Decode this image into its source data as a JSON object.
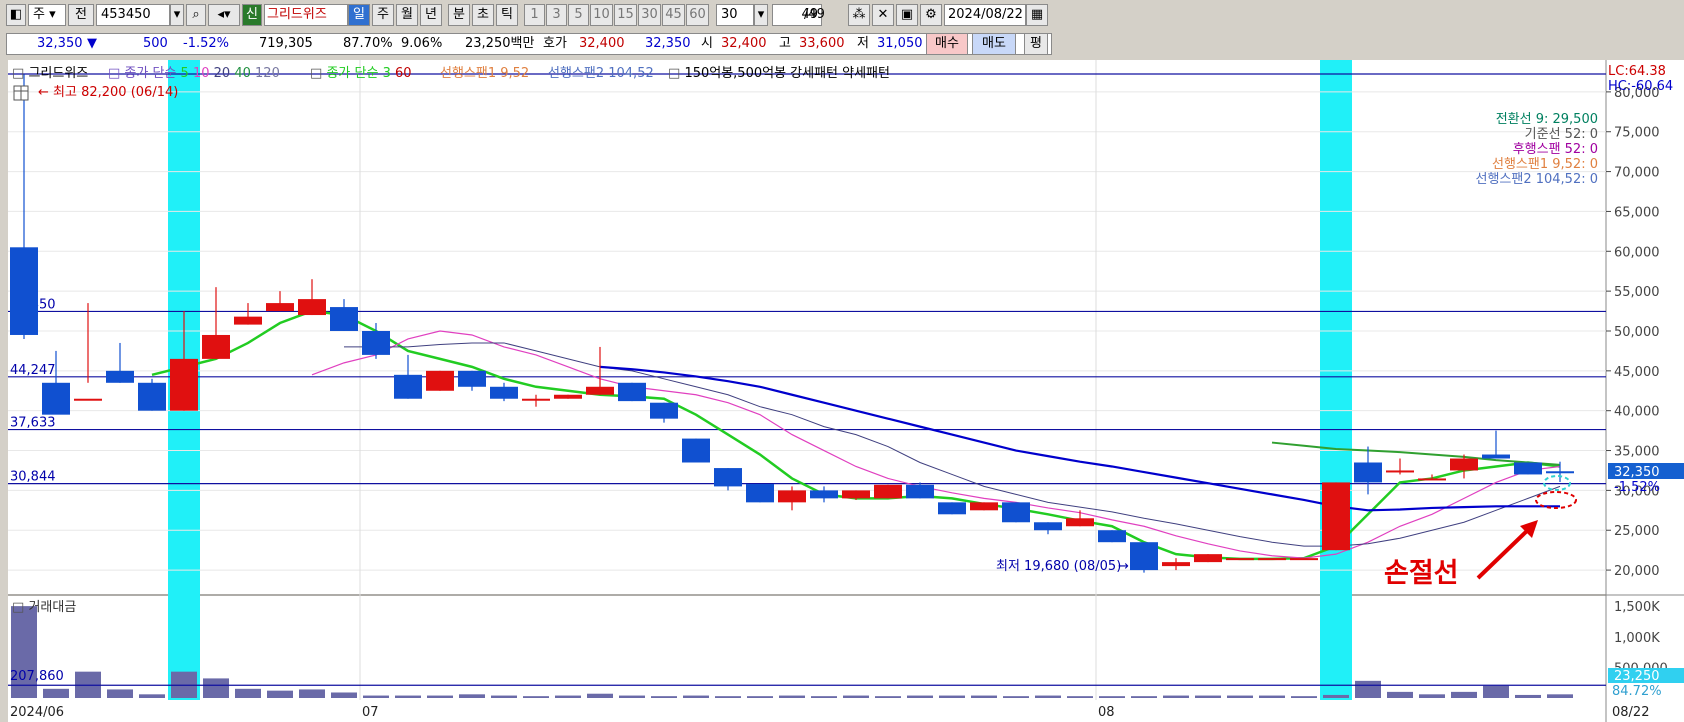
{
  "toolbar": {
    "period_main": "주",
    "jeon": "전",
    "code": "453450",
    "new_badge": "신",
    "stock_name": "그리드위즈",
    "periods": [
      "일",
      "주",
      "월",
      "년",
      "분",
      "초",
      "틱"
    ],
    "active_period": "일",
    "intervals": [
      "1",
      "3",
      "5",
      "10",
      "15",
      "30",
      "45",
      "60"
    ],
    "interval_select": "30",
    "count": "49",
    "count_total": "/49",
    "date": "2024/08/22"
  },
  "quote": {
    "price": "32,350",
    "arrow": "▼",
    "change": "500",
    "change_pct": "-1.52%",
    "volume": "719,305",
    "ratio1": "87.70%",
    "ratio2": "9.06%",
    "amount": "23,250백만",
    "hoga_label": "호가",
    "ask": "32,400",
    "bid": "32,350",
    "open_label": "시",
    "open": "32,400",
    "high_label": "고",
    "high": "33,600",
    "low_label": "저",
    "low": "31,050",
    "buy": "매수",
    "sell": "매도",
    "flat": "평"
  },
  "legend": {
    "name": "그리드위즈",
    "ma1_label": "종가 단순",
    "ma1_periods": [
      "5",
      "10",
      "20",
      "40",
      "120"
    ],
    "ma2_label": "종가 단순",
    "ma2_periods": [
      "3",
      "60"
    ],
    "span1": "선행스팬1 9,52",
    "span2": "선행스팬2 104,52",
    "pattern": "150억봉,500억봉 강세패턴  약세패턴"
  },
  "annotations": {
    "high": "최고 82,200 (06/14)",
    "low": "최저 19,680 (08/05)",
    "stoploss": "손절선",
    "lc": "LC:64.38",
    "hc": "HC:-60.64",
    "cur_price": "32,350",
    "cur_pct": "-1.52%",
    "vol_title": "거래대금",
    "vol_level": "207,860",
    "vol_cur": "23,250",
    "vol_pct": "84.72%",
    "ichimoku": [
      {
        "text": "전환선 9: 29,500",
        "color": "#008060"
      },
      {
        "text": "기준선 52: 0",
        "color": "#555555"
      },
      {
        "text": "후행스팬 52: 0",
        "color": "#a000a0"
      },
      {
        "text": "선행스팬1 9,52: 0",
        "color": "#e08040"
      },
      {
        "text": "선행스팬2 104,52: 0",
        "color": "#5070c0"
      }
    ]
  },
  "chart_data": {
    "type": "candlestick",
    "y_range": [
      17000,
      84000
    ],
    "y_ticks": [
      20000,
      25000,
      30000,
      35000,
      40000,
      45000,
      50000,
      55000,
      60000,
      65000,
      70000,
      75000,
      80000
    ],
    "y_tick_labels": [
      "20,000",
      "25,000",
      "30,000",
      "35,000",
      "40,000",
      "45,000",
      "50,000",
      "55,000",
      "60,000",
      "65,000",
      "70,000",
      "75,000",
      "80,000"
    ],
    "h_levels": [
      52450,
      44247,
      37633,
      30844
    ],
    "h_level_labels": [
      "52,450",
      "44,247",
      "37,633",
      "30,844"
    ],
    "x_labels": [
      {
        "index": 0,
        "text": "2024/06"
      },
      {
        "index": 11,
        "text": "07"
      },
      {
        "index": 34,
        "text": "08"
      },
      {
        "index": 49,
        "text": "08/22"
      }
    ],
    "highlight_indices": [
      5,
      41
    ],
    "candles": [
      [
        60500,
        82200,
        49000,
        49500
      ],
      [
        43500,
        47500,
        40500,
        39500
      ],
      [
        41500,
        53500,
        43500,
        41500
      ],
      [
        45000,
        48500,
        43500,
        43500
      ],
      [
        43500,
        44000,
        40000,
        40000
      ],
      [
        40000,
        52500,
        40000,
        46500
      ],
      [
        46500,
        55500,
        46500,
        49500
      ],
      [
        50800,
        53500,
        50800,
        51800
      ],
      [
        52500,
        55000,
        52500,
        53500
      ],
      [
        52000,
        56500,
        52000,
        54000
      ],
      [
        53000,
        54000,
        50000,
        50000
      ],
      [
        50000,
        51000,
        46500,
        47000
      ],
      [
        44500,
        47000,
        41500,
        41500
      ],
      [
        42500,
        45000,
        42500,
        45000
      ],
      [
        45000,
        45000,
        42500,
        43000
      ],
      [
        43000,
        43500,
        41200,
        41500
      ],
      [
        41500,
        42000,
        40500,
        41500
      ],
      [
        41500,
        42000,
        41500,
        42000
      ],
      [
        42000,
        48000,
        42000,
        43000
      ],
      [
        43500,
        43500,
        41200,
        41200
      ],
      [
        41000,
        41000,
        38500,
        39000
      ],
      [
        36500,
        36500,
        33500,
        33500
      ],
      [
        32800,
        32800,
        30000,
        30500
      ],
      [
        30800,
        30800,
        28500,
        28500
      ],
      [
        28500,
        30500,
        27500,
        30000
      ],
      [
        30000,
        30500,
        28500,
        29000
      ],
      [
        29000,
        30000,
        28800,
        30000
      ],
      [
        29000,
        30700,
        29000,
        30700
      ],
      [
        30700,
        31000,
        29000,
        29000
      ],
      [
        28500,
        28500,
        27000,
        27000
      ],
      [
        27500,
        28500,
        27500,
        28500
      ],
      [
        28500,
        28500,
        26000,
        26000
      ],
      [
        26000,
        26000,
        24500,
        25000
      ],
      [
        25500,
        27500,
        25500,
        26500
      ],
      [
        25000,
        25000,
        23500,
        23500
      ],
      [
        23500,
        23500,
        19680,
        20000
      ],
      [
        20500,
        21500,
        20000,
        21000
      ],
      [
        21000,
        22000,
        21000,
        22000
      ],
      [
        21500,
        21500,
        21500,
        21500
      ],
      [
        21500,
        21500,
        21500,
        21500
      ],
      [
        21500,
        21500,
        21500,
        21500
      ],
      [
        22500,
        31000,
        22500,
        31000
      ],
      [
        33500,
        35500,
        29500,
        31000
      ],
      [
        32500,
        34000,
        32000,
        32500
      ],
      [
        31500,
        32000,
        31500,
        31500
      ],
      [
        32500,
        34500,
        31500,
        34000
      ],
      [
        34500,
        37500,
        34000,
        34000
      ],
      [
        33500,
        33500,
        32000,
        32000
      ],
      [
        32400,
        33600,
        31050,
        32350
      ]
    ],
    "volume": [
      1500,
      150,
      430,
      140,
      60,
      430,
      320,
      150,
      120,
      140,
      90,
      40,
      40,
      40,
      60,
      40,
      30,
      40,
      70,
      40,
      30,
      40,
      30,
      30,
      40,
      30,
      40,
      30,
      40,
      40,
      40,
      30,
      40,
      30,
      30,
      30,
      40,
      40,
      40,
      40,
      30,
      50,
      280,
      100,
      60,
      100,
      200,
      50,
      60
    ],
    "volume_range": [
      0,
      1600
    ],
    "volume_ticks": [
      500,
      1000,
      1500
    ],
    "volume_tick_labels": [
      "500,000",
      "1,000K",
      "1,500K"
    ],
    "volume_level": 207.86,
    "series": [
      {
        "name": "5",
        "color": "#22cc22",
        "width": 2.5,
        "values": [
          null,
          null,
          null,
          null,
          44500,
          45500,
          46500,
          48500,
          51000,
          52500,
          52000,
          50000,
          47500,
          46500,
          45500,
          44000,
          43000,
          42500,
          42000,
          41800,
          41500,
          39500,
          37000,
          34500,
          31500,
          29500,
          29000,
          29000,
          29300,
          29000,
          28300,
          27700,
          27000,
          26200,
          25500,
          23500,
          22000,
          21600,
          21400,
          21400,
          21500,
          23000,
          27000,
          31000,
          31500,
          32500,
          33000,
          33500,
          33000
        ]
      },
      {
        "name": "10",
        "color": "#e040c0",
        "width": 1.2,
        "values": [
          null,
          null,
          null,
          null,
          null,
          null,
          null,
          null,
          null,
          44500,
          46000,
          47000,
          49000,
          50000,
          49500,
          48000,
          47000,
          45500,
          44000,
          43000,
          42500,
          42000,
          41000,
          39500,
          37000,
          35000,
          33000,
          31500,
          30500,
          29700,
          29000,
          28500,
          27800,
          27200,
          26300,
          25500,
          24300,
          23300,
          22400,
          21800,
          21500,
          22000,
          23500,
          25500,
          27000,
          29000,
          31000,
          32500,
          33000
        ]
      },
      {
        "name": "20",
        "color": "#404080",
        "width": 1,
        "values": [
          null,
          null,
          null,
          null,
          null,
          null,
          null,
          null,
          null,
          null,
          48000,
          48000,
          48000,
          48300,
          48500,
          48500,
          47500,
          46500,
          45500,
          45000,
          44000,
          43000,
          42000,
          40500,
          39500,
          38000,
          37000,
          35500,
          33500,
          32000,
          30500,
          29500,
          28500,
          27900,
          27300,
          26500,
          25800,
          25000,
          24200,
          23500,
          23000,
          23000,
          23300,
          24000,
          25000,
          26000,
          27500,
          29000,
          30500
        ]
      },
      {
        "name": "60",
        "color": "#0000cc",
        "width": 2.2,
        "values": [
          null,
          null,
          null,
          null,
          null,
          null,
          null,
          null,
          null,
          null,
          null,
          null,
          null,
          null,
          null,
          null,
          null,
          null,
          45500,
          45200,
          44800,
          44300,
          43700,
          43000,
          42000,
          41000,
          40000,
          39000,
          38000,
          37000,
          36000,
          35000,
          34300,
          33600,
          33000,
          32300,
          31600,
          30900,
          30200,
          29500,
          28800,
          28000,
          27500,
          27600,
          27800,
          27900,
          28000,
          28000,
          28000
        ]
      },
      {
        "name": "전환선",
        "color": "#30a030",
        "width": 2,
        "values": [
          null,
          null,
          null,
          null,
          null,
          null,
          null,
          null,
          null,
          null,
          null,
          null,
          null,
          null,
          null,
          null,
          null,
          null,
          null,
          null,
          null,
          null,
          null,
          null,
          null,
          null,
          null,
          null,
          null,
          null,
          null,
          null,
          null,
          null,
          null,
          null,
          null,
          null,
          null,
          36000,
          35600,
          35200,
          35000,
          34800,
          34500,
          34200,
          33800,
          33500,
          33200
        ]
      }
    ]
  }
}
